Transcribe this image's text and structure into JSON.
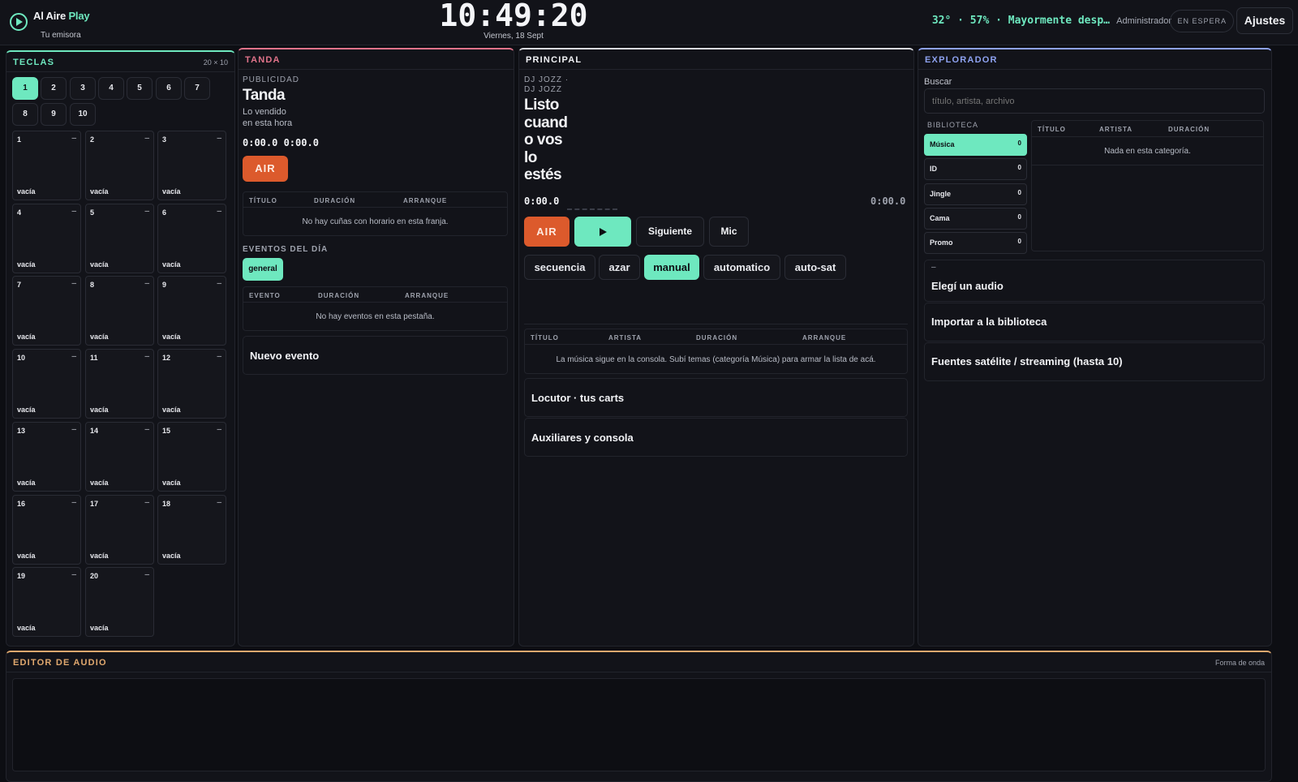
{
  "header": {
    "app_name_a": "Al Aire",
    "app_name_b": "Play",
    "station": "Tu emisora",
    "clock": "10:49:20",
    "date": "Viernes, 18 Sept",
    "weather": "32° · 57% · Mayormente desp…",
    "user": "Administrador",
    "status": "EN ESPERA",
    "settings": "Ajustes"
  },
  "teclas": {
    "title": "TECLAS",
    "grid": "20 × 10",
    "pages": [
      "1",
      "2",
      "3",
      "4",
      "5",
      "6",
      "7",
      "8",
      "9",
      "10"
    ],
    "active_page": "1",
    "carts": [
      {
        "num": "1",
        "dash": "–",
        "state": "vacía"
      },
      {
        "num": "2",
        "dash": "–",
        "state": "vacía"
      },
      {
        "num": "3",
        "dash": "–",
        "state": "vacía"
      },
      {
        "num": "4",
        "dash": "–",
        "state": "vacía"
      },
      {
        "num": "5",
        "dash": "–",
        "state": "vacía"
      },
      {
        "num": "6",
        "dash": "–",
        "state": "vacía"
      },
      {
        "num": "7",
        "dash": "–",
        "state": "vacía"
      },
      {
        "num": "8",
        "dash": "–",
        "state": "vacía"
      },
      {
        "num": "9",
        "dash": "–",
        "state": "vacía"
      },
      {
        "num": "10",
        "dash": "–",
        "state": "vacía"
      },
      {
        "num": "11",
        "dash": "–",
        "state": "vacía"
      },
      {
        "num": "12",
        "dash": "–",
        "state": "vacía"
      },
      {
        "num": "13",
        "dash": "–",
        "state": "vacía"
      },
      {
        "num": "14",
        "dash": "–",
        "state": "vacía"
      },
      {
        "num": "15",
        "dash": "–",
        "state": "vacía"
      },
      {
        "num": "16",
        "dash": "–",
        "state": "vacía"
      },
      {
        "num": "17",
        "dash": "–",
        "state": "vacía"
      },
      {
        "num": "18",
        "dash": "–",
        "state": "vacía"
      },
      {
        "num": "19",
        "dash": "–",
        "state": "vacía"
      },
      {
        "num": "20",
        "dash": "–",
        "state": "vacía"
      }
    ]
  },
  "tanda": {
    "title": "TANDA",
    "section": "PUBLICIDAD",
    "heading": "Tanda",
    "sub1": "Lo vendido",
    "sub2": "en esta hora",
    "times": "0:00.0 0:00.0",
    "air": "AIR",
    "cols": [
      "TÍTULO",
      "DURACIÓN",
      "ARRANQUE"
    ],
    "empty": "No hay cuñas con horario en esta franja.",
    "events_label": "EVENTOS DEL DÍA",
    "events_tab": "general",
    "events_cols": [
      "EVENTO",
      "DURACIÓN",
      "ARRANQUE"
    ],
    "events_empty": "No hay eventos en esta pestaña.",
    "new_event": "Nuevo evento"
  },
  "principal": {
    "title": "PRINCIPAL",
    "artist1": "DJ JOZZ ·",
    "artist2": "DJ JOZZ",
    "ready": [
      "Listo",
      "cuand",
      "o vos",
      "lo",
      "estés"
    ],
    "elapsed": "0:00.0",
    "remaining": "0:00.0",
    "air": "AIR",
    "play_icon": "play-icon",
    "next": "Siguiente",
    "mic": "Mic",
    "modes": [
      "secuencia",
      "azar",
      "manual",
      "automatico",
      "auto-sat"
    ],
    "active_mode": "manual",
    "cols": [
      "TÍTULO",
      "ARTISTA",
      "DURACIÓN",
      "ARRANQUE"
    ],
    "empty": "La música sigue en la consola. Subí temas (categoría Música) para armar la lista de acá.",
    "locutor": "Locutor · tus carts",
    "aux": "Auxiliares y consola"
  },
  "explorador": {
    "title": "EXPLORADOR",
    "search_label": "Buscar",
    "search_placeholder": "título, artista, archivo",
    "library_label": "BIBLIOTECA",
    "categories": [
      {
        "name": "Música",
        "count": "0"
      },
      {
        "name": "ID",
        "count": "0"
      },
      {
        "name": "Jingle",
        "count": "0"
      },
      {
        "name": "Cama",
        "count": "0"
      },
      {
        "name": "Promo",
        "count": "0"
      }
    ],
    "cols": [
      "TÍTULO",
      "ARTISTA",
      "DURACIÓN"
    ],
    "empty": "Nada en esta categoría.",
    "selected_dash": "–",
    "choose_audio": "Elegí un audio",
    "import": "Importar a la biblioteca",
    "sources": "Fuentes satélite / streaming (hasta 10)"
  },
  "editor": {
    "title": "EDITOR DE AUDIO",
    "waveform": "Forma de onda"
  },
  "colors": {
    "accent": "#6ee8bf",
    "air": "#dc5a2c",
    "tanda": "#e0738a",
    "explorador": "#8ea2f0",
    "editor": "#e0a86e"
  }
}
